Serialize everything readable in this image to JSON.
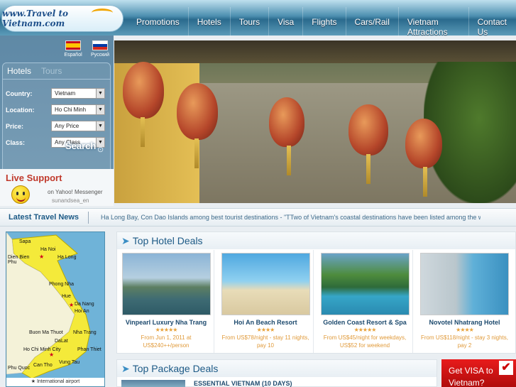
{
  "logo": {
    "text": "www.Travel to Vietnam.com"
  },
  "nav": [
    "Promotions",
    "Hotels",
    "Tours",
    "Visa",
    "Flights",
    "Cars/Rail",
    "Vietnam Attractions",
    "Contact Us"
  ],
  "languages": [
    {
      "label": "Español",
      "flag": "spain"
    },
    {
      "label": "Русский",
      "flag": "russia"
    }
  ],
  "search": {
    "tabs": [
      "Hotels",
      "Tours"
    ],
    "active_tab": "Hotels",
    "fields": [
      {
        "label": "Country:",
        "value": "Vietnam"
      },
      {
        "label": "Location:",
        "value": "Ho Chi Minh"
      },
      {
        "label": "Price:",
        "value": "Any Price"
      },
      {
        "label": "Class:",
        "value": "Any Class"
      }
    ],
    "button": "Search"
  },
  "live_support": {
    "title": "Live Support",
    "messenger": "on Yahoo! Messenger",
    "username": "sunandsea_en"
  },
  "news": {
    "title": "Latest Travel News",
    "ticker": "Ha Long Bay, Con Dao Islands among best tourist destinations - \"TTwo of Vietnam's coastal destinations have been listed among the world's ten"
  },
  "map": {
    "cities": [
      "Sapa",
      "Ha Noi",
      "Dien Bien Phu",
      "Ha Long",
      "Phong Nha",
      "Hue",
      "Da Nang",
      "Hoi An",
      "Nha Trang",
      "Buon Ma Thuot",
      "DaLat",
      "Ho Chi Minh City",
      "Phan Thiet",
      "Phu Quoc",
      "Vung Tau",
      "Can Tho"
    ],
    "legend": "★ International airport"
  },
  "hotel_deals": {
    "title": "Top Hotel Deals",
    "items": [
      {
        "name": "Vinpearl Luxury Nha Trang",
        "stars": "★★★★★",
        "price": "From Jun 1, 2011 at US$240++/person"
      },
      {
        "name": "Hoi An Beach Resort",
        "stars": "★★★★",
        "price": "From US$78/night - stay 11 nights, pay 10"
      },
      {
        "name": "Golden Coast Resort & Spa",
        "stars": "★★★★★",
        "price": "From US$45/night for weekdays, US$52 for weekend"
      },
      {
        "name": "Novotel Nhatrang Hotel",
        "stars": "★★★★",
        "price": "From US$118/night - stay 3 nights, pay 2"
      }
    ]
  },
  "package_deals": {
    "title": "Top Package Deals",
    "first_item": "ESSENTIAL VIETNAM (10 DAYS)"
  },
  "visa_promo": {
    "line1": "Get VISA to",
    "line2": "Vietnam?",
    "check": "✔"
  },
  "colors": {
    "header": "#2a6a8d",
    "accent": "#1d5a86",
    "price": "#e09a3a",
    "visa": "#d01010"
  }
}
